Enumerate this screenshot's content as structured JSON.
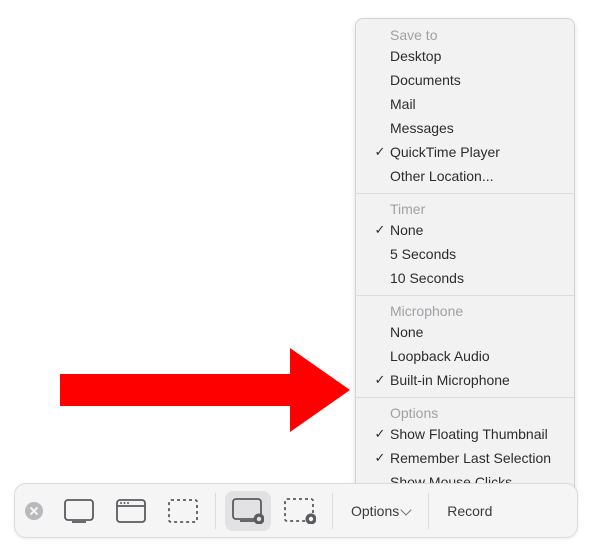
{
  "menu": {
    "sections": [
      {
        "header": "Save to",
        "items": [
          {
            "label": "Desktop",
            "checked": false
          },
          {
            "label": "Documents",
            "checked": false
          },
          {
            "label": "Mail",
            "checked": false
          },
          {
            "label": "Messages",
            "checked": false
          },
          {
            "label": "QuickTime Player",
            "checked": true
          },
          {
            "label": "Other Location...",
            "checked": false
          }
        ]
      },
      {
        "header": "Timer",
        "items": [
          {
            "label": "None",
            "checked": true
          },
          {
            "label": "5 Seconds",
            "checked": false
          },
          {
            "label": "10 Seconds",
            "checked": false
          }
        ]
      },
      {
        "header": "Microphone",
        "items": [
          {
            "label": "None",
            "checked": false
          },
          {
            "label": "Loopback Audio",
            "checked": false
          },
          {
            "label": "Built-in Microphone",
            "checked": true
          }
        ]
      },
      {
        "header": "Options",
        "items": [
          {
            "label": "Show Floating Thumbnail",
            "checked": true
          },
          {
            "label": "Remember Last Selection",
            "checked": true
          },
          {
            "label": "Show Mouse Clicks",
            "checked": false
          }
        ]
      }
    ]
  },
  "toolbar": {
    "options_label": "Options",
    "record_label": "Record"
  }
}
